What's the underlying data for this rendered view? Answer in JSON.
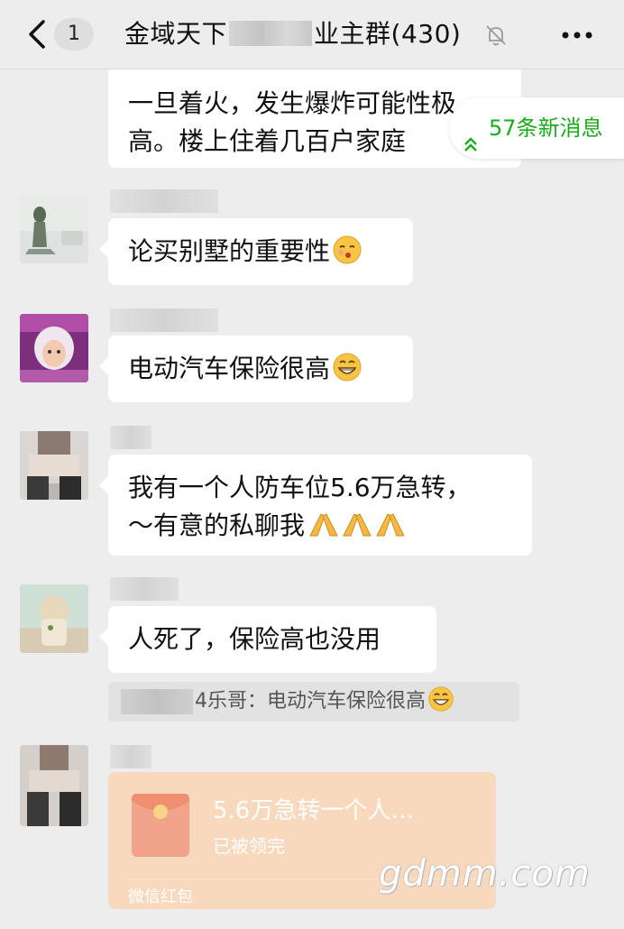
{
  "header": {
    "unread_badge": "1",
    "title_prefix": "金域天下",
    "title_suffix": "业主群(430)"
  },
  "new_messages_pill": "57条新消息",
  "messages": [
    {
      "text_lines": [
        "一旦着火，发生爆炸可能性极",
        "高。楼上住着几百户家庭"
      ]
    },
    {
      "text": "论买别墅的重要性"
    },
    {
      "text": "电动汽车保险很高"
    },
    {
      "text_lines": [
        "我有一个人防车位5.6万急转，",
        "～有意的私聊我"
      ]
    },
    {
      "text": "人死了，保险高也没用"
    }
  ],
  "quote": {
    "text": "4乐哥：电动汽车保险很高"
  },
  "red_packet": {
    "title": "5.6万急转一个人…",
    "status": "已被领完",
    "footer": "微信红包"
  },
  "watermark": "gdmm.com",
  "colors": {
    "background": "#ededed",
    "bubble": "#ffffff",
    "accent_green": "#1aad19",
    "red_packet_bg": "#f9d9bd"
  },
  "icons": [
    "back-chevron-icon",
    "mute-bell-icon",
    "more-dots-icon",
    "double-chevron-up-icon",
    "red-packet-icon"
  ]
}
